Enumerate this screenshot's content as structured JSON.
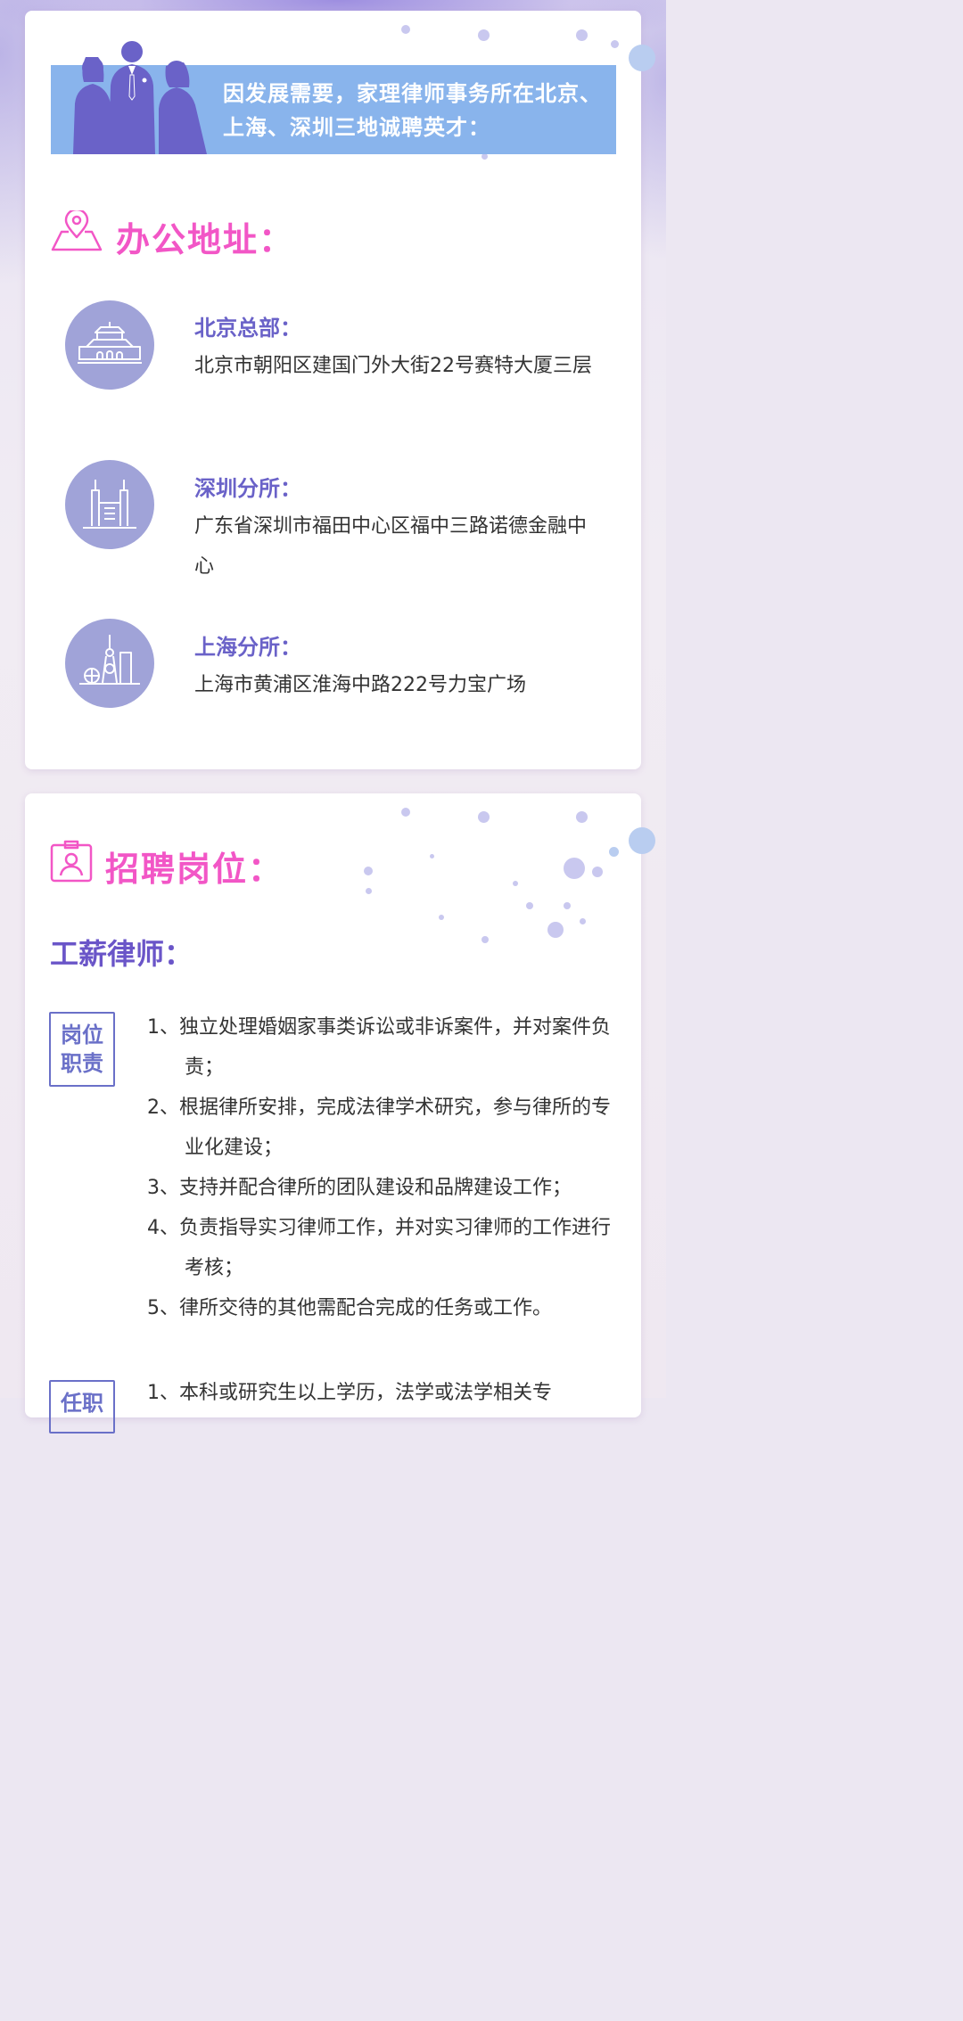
{
  "colors": {
    "card_bg": "#ffffff",
    "banner_bg": "#89b4ec",
    "section_title": "#f256c6",
    "office_name": "#6a62c8",
    "icon_circle": "#a0a3d8",
    "job_title": "#6a55c8",
    "tag_border": "#6a70c8",
    "body_text": "#333333"
  },
  "banner": {
    "icon": "business-people-icon",
    "text": "因发展需要，家理律师事务所在北京、上海、深圳三地诚聘英才："
  },
  "offices_section": {
    "icon": "map-pin-icon",
    "title": "办公地址："
  },
  "offices": [
    {
      "icon": "tiananmen-icon",
      "name": "北京总部：",
      "address": "北京市朝阳区建国门外大街22号赛特大厦三层"
    },
    {
      "icon": "skyscraper-icon",
      "name": "深圳分所：",
      "address": "广东省深圳市福田中心区福中三路诺德金融中心"
    },
    {
      "icon": "oriental-pearl-tower-icon",
      "name": "上海分所：",
      "address": "上海市黄浦区淮海中路222号力宝广场"
    }
  ],
  "jobs_section": {
    "icon": "id-badge-icon",
    "title": "招聘岗位："
  },
  "job": {
    "title": "工薪律师：",
    "duties_tag": "岗位职责",
    "duties": [
      "1、独立处理婚姻家事类诉讼或非诉案件，并对案件负责；",
      "2、根据律所安排，完成法律学术研究，参与律所的专业化建设；",
      "3、支持并配合律所的团队建设和品牌建设工作；",
      "4、负责指导实习律师工作，并对实习律师的工作进行考核；",
      "5、律所交待的其他需配合完成的任务或工作。"
    ],
    "requirements_tag": "任职",
    "requirements": [
      "1、本科或研究生以上学历，法学或法学相关专"
    ]
  }
}
